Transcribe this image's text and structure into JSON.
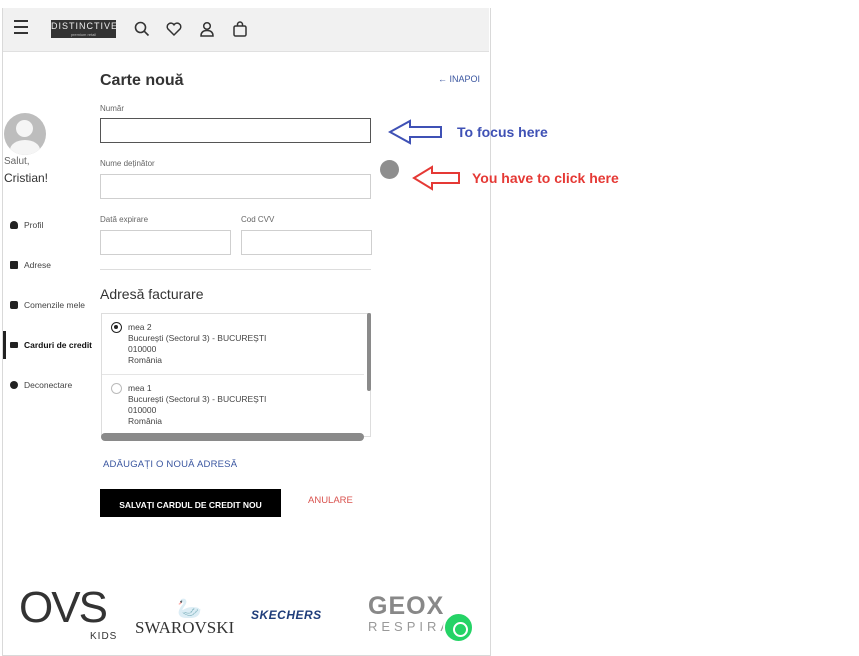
{
  "topbar": {
    "logo_text": "DISTINCTIVE",
    "logo_subtext": "premium retail"
  },
  "sidebar": {
    "greeting_line1": "Salut,",
    "greeting_line2": "Cristian!",
    "items": [
      {
        "label": "Profil"
      },
      {
        "label": "Adrese"
      },
      {
        "label": "Comenzile mele"
      },
      {
        "label": "Carduri de credit"
      },
      {
        "label": "Deconectare"
      }
    ]
  },
  "form": {
    "title": "Carte nouă",
    "back_link": "← INAPOI",
    "number_label": "Număr",
    "number_value": "",
    "holder_label": "Nume deținător",
    "holder_value": "",
    "expiry_label": "Dată expirare",
    "expiry_value": "",
    "cvv_label": "Cod CVV",
    "cvv_value": ""
  },
  "billing": {
    "title": "Adresă facturare",
    "addresses": [
      {
        "name": "mea 2",
        "line1": "București (Sectorul 3) - BUCUREȘTI",
        "postal": "010000",
        "country": "România",
        "selected": true
      },
      {
        "name": "mea 1",
        "line1": "București (Sectorul 3) - BUCUREȘTI",
        "postal": "010000",
        "country": "România",
        "selected": false
      }
    ],
    "add_address": "ADĂUGAȚI O NOUĂ ADRESĂ"
  },
  "actions": {
    "save_label": "SALVAȚI CARDUL DE CREDIT NOU",
    "cancel_label": "ANULARE"
  },
  "brands": {
    "ovs": "OVS",
    "ovs_sub": "KIDS",
    "swarovski": "SWAROVSKI",
    "skechers": "SKECHERS",
    "geox": "GEOX",
    "geox_sub": "RESPIRA"
  },
  "annotations": {
    "focus_text": "To focus here",
    "click_text": "You have to click here",
    "focus_color": "#3f51b5",
    "click_color": "#e53935"
  }
}
